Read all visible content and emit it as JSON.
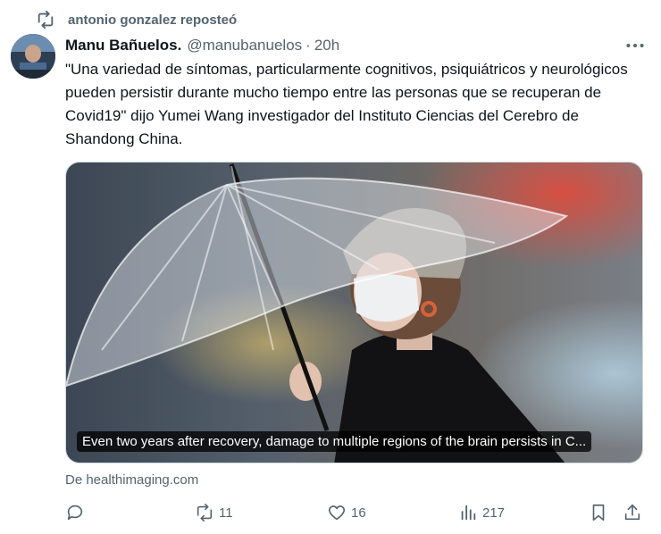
{
  "repost": {
    "text": "antonio gonzalez reposteó"
  },
  "author": {
    "name": "Manu Bañuelos.",
    "handle": "@manubanuelos",
    "time": "20h"
  },
  "tweet": {
    "text": "\"Una variedad de síntomas, particularmente cognitivos, psiquiátricos y neurológicos pueden persistir durante mucho tiempo entre las personas que se recuperan de Covid19\" dijo Yumei Wang investigador del Instituto Ciencias del Cerebro de Shandong China."
  },
  "card": {
    "caption": "Even two years after recovery, damage to multiple regions of the brain persists in C...",
    "source": "De healthimaging.com"
  },
  "actions": {
    "reply": {
      "icon": "reply-icon",
      "count": ""
    },
    "repost": {
      "icon": "repost-icon",
      "count": "11"
    },
    "like": {
      "icon": "heart-icon",
      "count": "16"
    },
    "views": {
      "icon": "views-icon",
      "count": "217"
    },
    "bookmark": {
      "icon": "bookmark-icon"
    },
    "share": {
      "icon": "share-icon"
    }
  },
  "colors": {
    "text": "#0f1419",
    "secondary": "#536471",
    "border": "#cfd9de"
  }
}
